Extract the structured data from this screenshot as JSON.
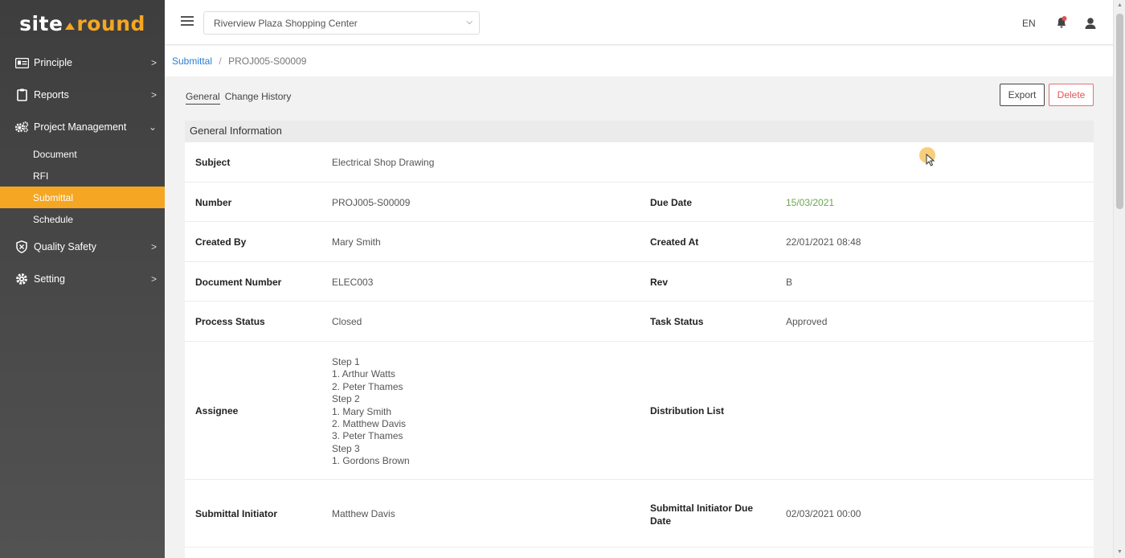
{
  "logo": {
    "part1": "site",
    "part2": "round"
  },
  "sidebar": {
    "items": [
      {
        "label": "Principle",
        "icon": "id-card-icon"
      },
      {
        "label": "Reports",
        "icon": "clipboard-icon"
      },
      {
        "label": "Project Management",
        "icon": "gears-icon"
      },
      {
        "label": "Quality Safety",
        "icon": "shield-icon"
      },
      {
        "label": "Setting",
        "icon": "gear-icon"
      }
    ],
    "sub_items": [
      "Document",
      "RFI",
      "Submittal",
      "Schedule"
    ],
    "active_sub": "Submittal"
  },
  "topbar": {
    "project": "Riverview Plaza Shopping Center",
    "language": "EN"
  },
  "breadcrumb": {
    "parent": "Submittal",
    "separator": "/",
    "current": "PROJ005-S00009"
  },
  "tabs": {
    "general": "General",
    "history": "Change History"
  },
  "actions": {
    "export": "Export",
    "delete": "Delete"
  },
  "card": {
    "title": "General Information",
    "fields": {
      "subject_label": "Subject",
      "subject": "Electrical Shop Drawing",
      "number_label": "Number",
      "number": "PROJ005-S00009",
      "due_label": "Due Date",
      "due": "15/03/2021",
      "created_by_label": "Created By",
      "created_by": "Mary Smith",
      "created_at_label": "Created At",
      "created_at": "22/01/2021 08:48",
      "doc_number_label": "Document Number",
      "doc_number": "ELEC003",
      "rev_label": "Rev",
      "rev": "B",
      "process_status_label": "Process Status",
      "process_status": "Closed",
      "task_status_label": "Task Status",
      "task_status": "Approved",
      "assignee_label": "Assignee",
      "assignee_lines": [
        "Step 1",
        "1. Arthur Watts",
        "2. Peter Thames",
        "Step 2",
        "1. Mary Smith",
        "2. Matthew Davis",
        "3. Peter Thames",
        "Step 3",
        "1. Gordons Brown"
      ],
      "distribution_label": "Distribution List",
      "initiator_label": "Submittal Initiator",
      "initiator": "Matthew Davis",
      "initiator_due_label_1": "Submittal Initiator Due",
      "initiator_due_label_2": "Date",
      "initiator_due": "02/03/2021 00:00"
    }
  },
  "colors": {
    "accent": "#f5a623",
    "due_date": "#6aa84f",
    "delete": "#e05555",
    "link": "#2b7fd0"
  }
}
